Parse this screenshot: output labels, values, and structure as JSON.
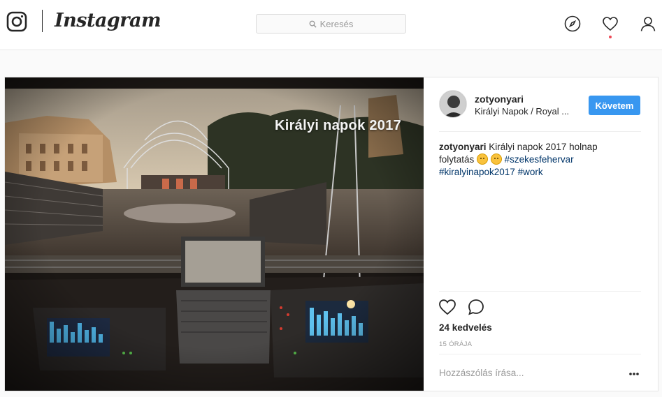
{
  "header": {
    "brand": "Instagram",
    "search_placeholder": "Keresés",
    "icons": [
      "instagram-glyph-icon",
      "search-icon",
      "compass-icon",
      "heart-icon",
      "profile-icon"
    ],
    "notification_dot_color": "#ed4956"
  },
  "post": {
    "image_overlay_text": "Királyi napok 2017",
    "user": "zotyonyari",
    "location": "Királyi Napok / Royal ...",
    "follow_label": "Követem",
    "follow_color": "#3897f0",
    "caption_user": "zotyonyari",
    "caption_text_1": "Királyi napok 2017 holnap folytatás",
    "caption_tag_1": "#szekesfehervar",
    "caption_tag_2": "#kiralyinapok2017",
    "caption_tag_3": "#work",
    "emoji_icons": [
      "rolling-eyes-emoji",
      "smile-emoji"
    ],
    "likes": "24 kedvelés",
    "time": "15 ÓRÁJA",
    "comment_placeholder": "Hozzászólás írása...",
    "more_icon": "ellipsis-icon"
  }
}
